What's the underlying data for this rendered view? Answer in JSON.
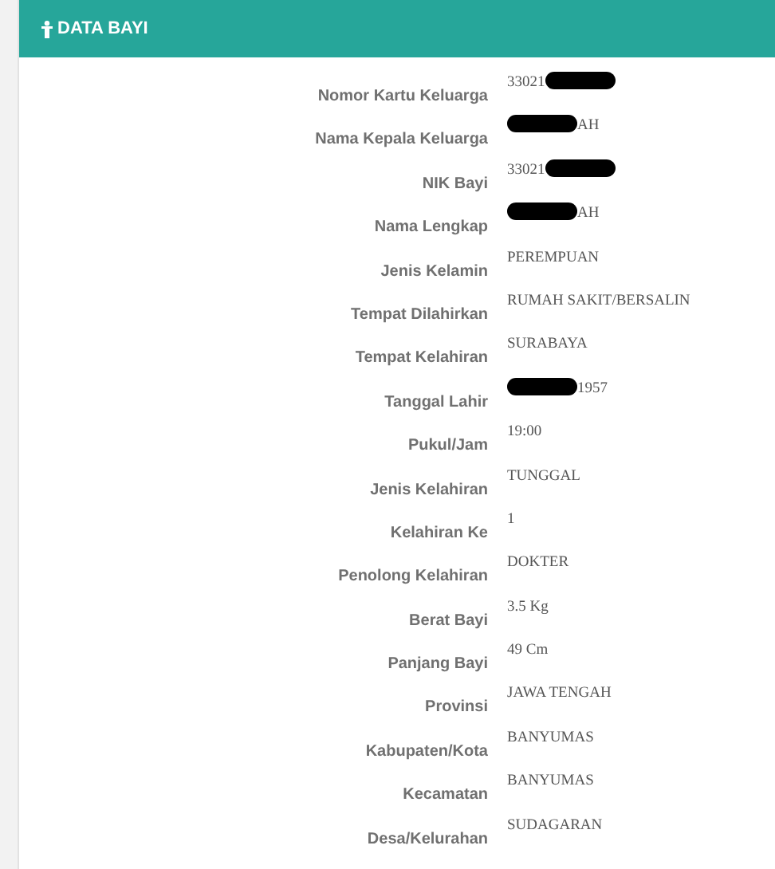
{
  "panel": {
    "title": "DATA BAYI"
  },
  "fields": [
    {
      "label": "Nomor Kartu Keluarga",
      "parts": [
        {
          "kind": "text",
          "text": "33021"
        },
        {
          "kind": "redaction"
        }
      ]
    },
    {
      "label": "Nama Kepala Keluarga",
      "parts": [
        {
          "kind": "redaction"
        },
        {
          "kind": "text",
          "text": "AH"
        }
      ]
    },
    {
      "label": "NIK Bayi",
      "parts": [
        {
          "kind": "text",
          "text": "33021"
        },
        {
          "kind": "redaction"
        }
      ]
    },
    {
      "label": "Nama Lengkap",
      "parts": [
        {
          "kind": "redaction"
        },
        {
          "kind": "text",
          "text": "AH"
        }
      ]
    },
    {
      "label": "Jenis Kelamin",
      "parts": [
        {
          "kind": "text",
          "text": "PEREMPUAN"
        }
      ]
    },
    {
      "label": "Tempat Dilahirkan",
      "parts": [
        {
          "kind": "text",
          "text": "RUMAH SAKIT/BERSALIN"
        }
      ]
    },
    {
      "label": "Tempat Kelahiran",
      "parts": [
        {
          "kind": "text",
          "text": "SURABAYA"
        }
      ]
    },
    {
      "label": "Tanggal Lahir",
      "parts": [
        {
          "kind": "redaction"
        },
        {
          "kind": "text",
          "text": "1957"
        }
      ]
    },
    {
      "label": "Pukul/Jam",
      "parts": [
        {
          "kind": "text",
          "text": "19:00"
        }
      ]
    },
    {
      "label": "Jenis Kelahiran",
      "parts": [
        {
          "kind": "text",
          "text": "TUNGGAL"
        }
      ]
    },
    {
      "label": "Kelahiran Ke",
      "parts": [
        {
          "kind": "text",
          "text": "1"
        }
      ]
    },
    {
      "label": "Penolong Kelahiran",
      "parts": [
        {
          "kind": "text",
          "text": "DOKTER"
        }
      ]
    },
    {
      "label": "Berat Bayi",
      "parts": [
        {
          "kind": "text",
          "text": "3.5 Kg"
        }
      ]
    },
    {
      "label": "Panjang Bayi",
      "parts": [
        {
          "kind": "text",
          "text": "49 Cm"
        }
      ]
    },
    {
      "label": "Provinsi",
      "parts": [
        {
          "kind": "text",
          "text": "JAWA TENGAH"
        }
      ]
    },
    {
      "label": "Kabupaten/Kota",
      "parts": [
        {
          "kind": "text",
          "text": "BANYUMAS"
        }
      ]
    },
    {
      "label": "Kecamatan",
      "parts": [
        {
          "kind": "text",
          "text": "BANYUMAS"
        }
      ]
    },
    {
      "label": "Desa/Kelurahan",
      "parts": [
        {
          "kind": "text",
          "text": "SUDAGARAN"
        }
      ]
    }
  ]
}
